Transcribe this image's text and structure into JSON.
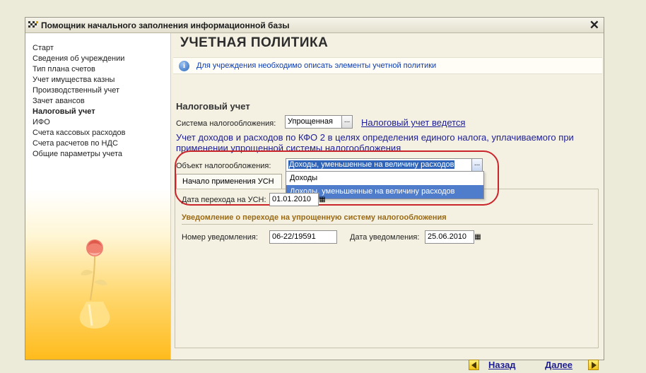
{
  "window": {
    "title": "Помощник начального заполнения информационной базы"
  },
  "sidebar": {
    "items": [
      {
        "label": "Старт"
      },
      {
        "label": "Сведения об учреждении"
      },
      {
        "label": "Тип плана счетов"
      },
      {
        "label": "Учет имущества казны"
      },
      {
        "label": "Производственный учет"
      },
      {
        "label": "Зачет авансов"
      },
      {
        "label": "Налоговый учет"
      },
      {
        "label": "ИФО"
      },
      {
        "label": "Счета кассовых расходов"
      },
      {
        "label": "Счета расчетов по НДС"
      },
      {
        "label": "Общие параметры учета"
      }
    ]
  },
  "main": {
    "title": "УЧЕТНАЯ ПОЛИТИКА",
    "info": "Для учреждения необходимо описать элементы учетной политики",
    "section_title": "Налоговый учет",
    "tax_system_label": "Система налогообложения:",
    "tax_system_value": "Упрощенная",
    "tax_accounting_link": "Налоговый учет ведется",
    "description": "Учет доходов и расходов по КФО 2 в целях определения единого налога, уплачиваемого при применении упрощенной системы налогообложения",
    "tax_object_label": "Объект налогообложения:",
    "tax_object_value": "Доходы, уменьшенные на величину расходов",
    "dropdown_options": [
      {
        "label": "Доходы"
      },
      {
        "label": "Доходы, уменьшенные на величину расходов"
      }
    ],
    "tab_label": "Начало применения УСН",
    "transition_date_label": "Дата перехода на УСН:",
    "transition_date_value": "01.01.2010",
    "notification_section": "Уведомление о переходе на упрощенную систему налогообложения",
    "notification_number_label": "Номер уведомления:",
    "notification_number_value": "06-22/19591",
    "notification_date_label": "Дата уведомления:",
    "notification_date_value": "25.06.2010"
  },
  "footer": {
    "back_label": "Назад",
    "next_label": "Далее"
  },
  "colors": {
    "link": "#1d1d96",
    "highlight": "#4f7dcb",
    "annotation": "#c9262c"
  }
}
